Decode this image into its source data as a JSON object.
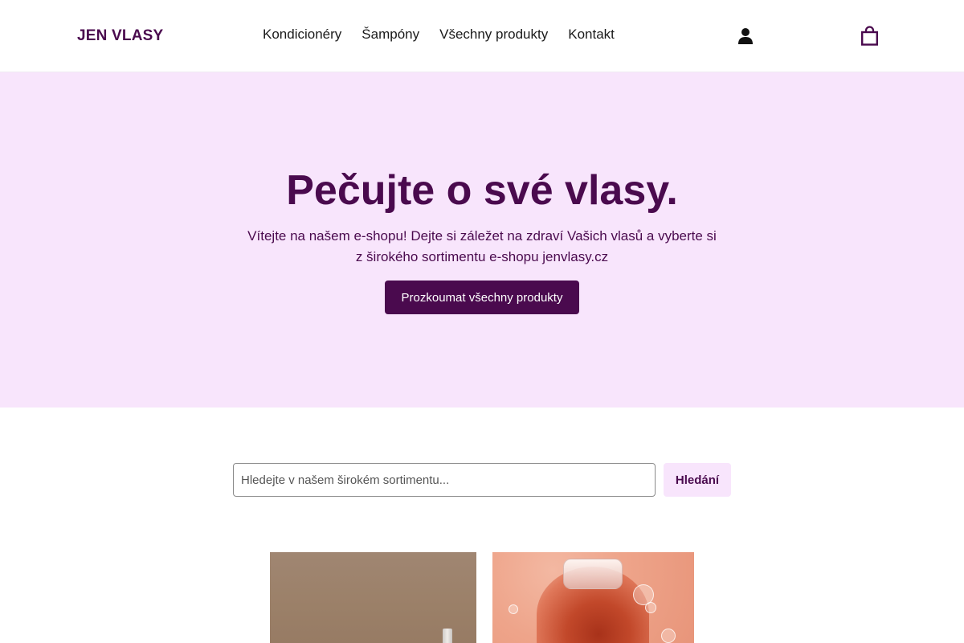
{
  "header": {
    "logo": "JEN VLASY",
    "nav": [
      {
        "label": "Kondicionéry"
      },
      {
        "label": "Šampóny"
      },
      {
        "label": "Všechny produkty"
      },
      {
        "label": "Kontakt"
      }
    ],
    "icons": {
      "account": "user-icon",
      "cart": "shopping-bag-icon"
    }
  },
  "hero": {
    "title": "Pečujte o své vlasy.",
    "subtitle_line1": "Vítejte na našem e-shopu! Dejte si záležet na zdraví Vašich vlasů a vyberte si",
    "subtitle_line2": "z širokého sortimentu e-shopu jenvlasy.cz",
    "cta_label": "Prozkoumat všechny produkty"
  },
  "search": {
    "placeholder": "Hledejte v našem širokém sortimentu...",
    "value": "",
    "button_label": "Hledání"
  },
  "colors": {
    "brand": "#4a0a4e",
    "hero_bg": "#f8e5fc",
    "search_button_bg": "#f8e5fc"
  }
}
